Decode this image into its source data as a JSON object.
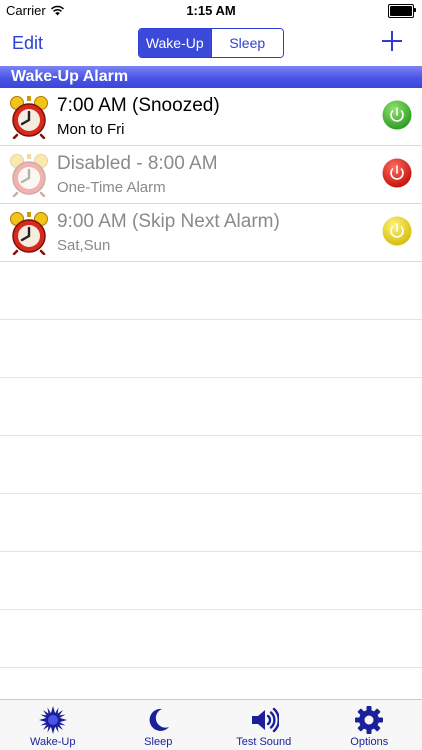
{
  "status_bar": {
    "carrier": "Carrier",
    "time": "1:15 AM"
  },
  "nav": {
    "edit_label": "Edit",
    "segments": [
      {
        "label": "Wake-Up",
        "selected": true
      },
      {
        "label": "Sleep",
        "selected": false
      }
    ],
    "add_icon": "plus-icon"
  },
  "section": {
    "title": "Wake-Up Alarm"
  },
  "alarms": [
    {
      "title": "7:00 AM (Snoozed)",
      "subtitle": "Mon to Fri",
      "enabled": true,
      "power_color": "#3cb52d",
      "dimmed": false,
      "icon_faded": false
    },
    {
      "title": "Disabled - 8:00 AM",
      "subtitle": "One-Time Alarm",
      "enabled": false,
      "power_color": "#d8211d",
      "dimmed": true,
      "icon_faded": true
    },
    {
      "title": "9:00 AM (Skip Next Alarm)",
      "subtitle": "Sat,Sun",
      "enabled": true,
      "power_color": "#e8d219",
      "dimmed": true,
      "icon_faded": false
    }
  ],
  "tabs": [
    {
      "label": "Wake-Up",
      "icon": "sun-icon"
    },
    {
      "label": "Sleep",
      "icon": "moon-icon"
    },
    {
      "label": "Test Sound",
      "icon": "speaker-icon"
    },
    {
      "label": "Options",
      "icon": "gear-icon"
    }
  ],
  "colors": {
    "accent": "#2b3fd6",
    "tab_icon": "#1b1f9a"
  }
}
